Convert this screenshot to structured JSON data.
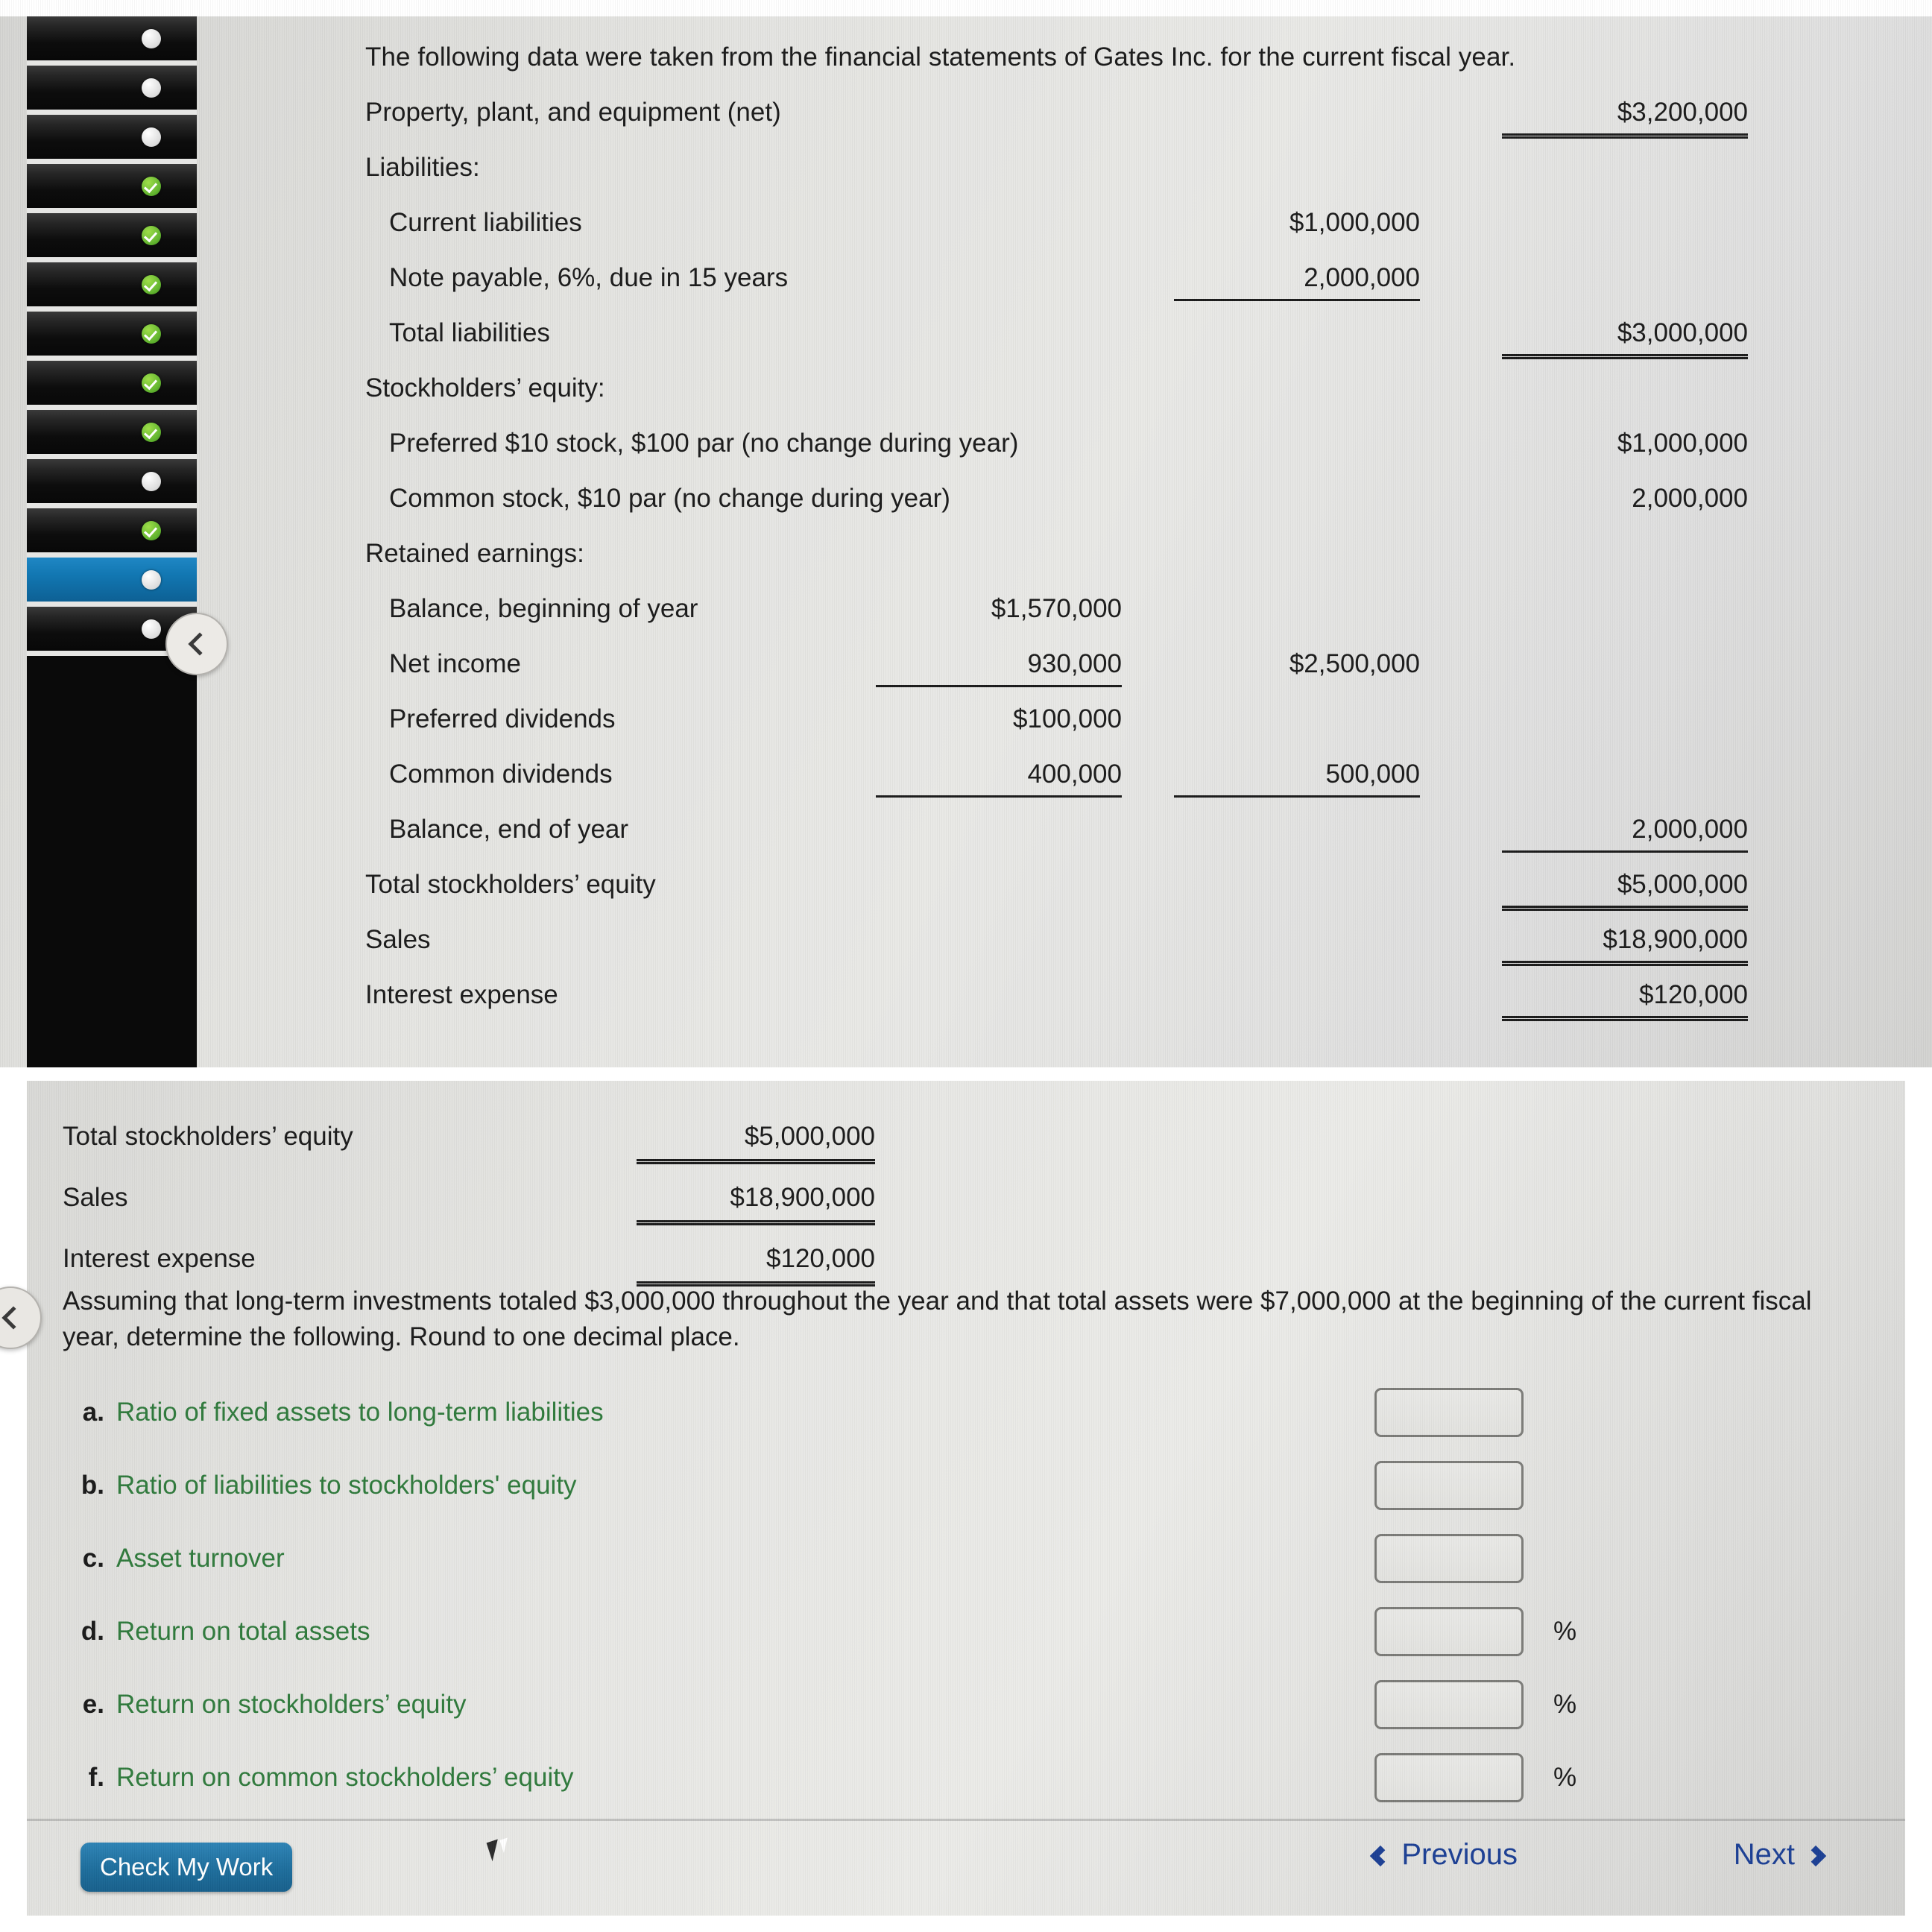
{
  "sidebar": {
    "items": [
      {
        "status": "unanswered",
        "selected": false
      },
      {
        "status": "unanswered",
        "selected": false
      },
      {
        "status": "unanswered",
        "selected": false
      },
      {
        "status": "answered",
        "selected": false
      },
      {
        "status": "answered",
        "selected": false
      },
      {
        "status": "answered",
        "selected": false
      },
      {
        "status": "answered",
        "selected": false
      },
      {
        "status": "answered",
        "selected": false
      },
      {
        "status": "answered",
        "selected": false
      },
      {
        "status": "unanswered",
        "selected": false
      },
      {
        "status": "answered",
        "selected": false
      },
      {
        "status": "unanswered",
        "selected": true
      },
      {
        "status": "unanswered",
        "selected": false
      }
    ]
  },
  "statement": {
    "intro": "The following data were taken from the financial statements of Gates Inc. for the current fiscal year.",
    "rows": [
      {
        "label": "Property, plant, and equipment (net)",
        "indent": 0,
        "c1": "",
        "c2": "",
        "c3": "$3,200,000",
        "rule": "double-c3"
      },
      {
        "label": "Liabilities:",
        "indent": 0,
        "c1": "",
        "c2": "",
        "c3": "",
        "rule": ""
      },
      {
        "label": "Current liabilities",
        "indent": 1,
        "c1": "",
        "c2": "$1,000,000",
        "c3": "",
        "rule": ""
      },
      {
        "label": "Note payable, 6%, due in 15 years",
        "indent": 1,
        "c1": "",
        "c2": "2,000,000",
        "c3": "",
        "rule": "single-c2"
      },
      {
        "label": "Total liabilities",
        "indent": 1,
        "c1": "",
        "c2": "",
        "c3": "$3,000,000",
        "rule": "double-c3"
      },
      {
        "label": "Stockholders’ equity:",
        "indent": 0,
        "c1": "",
        "c2": "",
        "c3": "",
        "rule": ""
      },
      {
        "label": "Preferred $10 stock, $100 par (no change during year)",
        "indent": 1,
        "c1": "",
        "c2": "",
        "c3": "$1,000,000",
        "rule": ""
      },
      {
        "label": "Common stock, $10 par (no change during year)",
        "indent": 1,
        "c1": "",
        "c2": "",
        "c3": "2,000,000",
        "rule": ""
      },
      {
        "label": "Retained earnings:",
        "indent": 0,
        "c1": "",
        "c2": "",
        "c3": "",
        "rule": ""
      },
      {
        "label": "Balance, beginning of year",
        "indent": 1,
        "c1": "$1,570,000",
        "c2": "",
        "c3": "",
        "rule": ""
      },
      {
        "label": "Net income",
        "indent": 1,
        "c1": "930,000",
        "c2": "$2,500,000",
        "c3": "",
        "rule": "single-c1"
      },
      {
        "label": "Preferred dividends",
        "indent": 1,
        "c1": "$100,000",
        "c2": "",
        "c3": "",
        "rule": ""
      },
      {
        "label": "Common dividends",
        "indent": 1,
        "c1": "400,000",
        "c2": "500,000",
        "c3": "",
        "rule": "single-c1-c2"
      },
      {
        "label": "Balance, end of year",
        "indent": 1,
        "c1": "",
        "c2": "",
        "c3": "2,000,000",
        "rule": "single-c3"
      },
      {
        "label": "Total stockholders’ equity",
        "indent": 0,
        "c1": "",
        "c2": "",
        "c3": "$5,000,000",
        "rule": "double-c3"
      },
      {
        "label": "Sales",
        "indent": 0,
        "c1": "",
        "c2": "",
        "c3": "$18,900,000",
        "rule": "double-c3"
      },
      {
        "label": "Interest expense",
        "indent": 0,
        "c1": "",
        "c2": "",
        "c3": "$120,000",
        "rule": "double-c3"
      }
    ]
  },
  "question": {
    "summary_rows": [
      {
        "label": "Total stockholders’ equity",
        "value": "$5,000,000",
        "rule": "double"
      },
      {
        "label": "Sales",
        "value": "$18,900,000",
        "rule": "double"
      },
      {
        "label": "Interest expense",
        "value": "$120,000",
        "rule": "double"
      }
    ],
    "prompt": "Assuming that long-term investments totaled $3,000,000 throughout the year and that total assets were $7,000,000 at the beginning of the current fiscal year, determine the following. Round to one decimal place.",
    "items": [
      {
        "letter": "a.",
        "text": "Ratio of fixed assets to long-term liabilities",
        "value": "",
        "suffix": ""
      },
      {
        "letter": "b.",
        "text": "Ratio of liabilities to stockholders' equity",
        "value": "",
        "suffix": ""
      },
      {
        "letter": "c.",
        "text": "Asset turnover",
        "value": "",
        "suffix": ""
      },
      {
        "letter": "d.",
        "text": "Return on total assets",
        "value": "",
        "suffix": "%"
      },
      {
        "letter": "e.",
        "text": "Return on stockholders’ equity",
        "value": "",
        "suffix": "%"
      },
      {
        "letter": "f.",
        "text": "Return on common stockholders’ equity",
        "value": "",
        "suffix": "%"
      }
    ]
  },
  "footer": {
    "check_label": "Check My Work",
    "previous_label": "Previous",
    "next_label": "Next"
  },
  "colors": {
    "question_green": "#2f7a3c",
    "nav_blue": "#1c3f94",
    "button_blue": "#1d6d9c",
    "selected_row_blue": "#1277b2",
    "answered_green": "#63b530"
  }
}
